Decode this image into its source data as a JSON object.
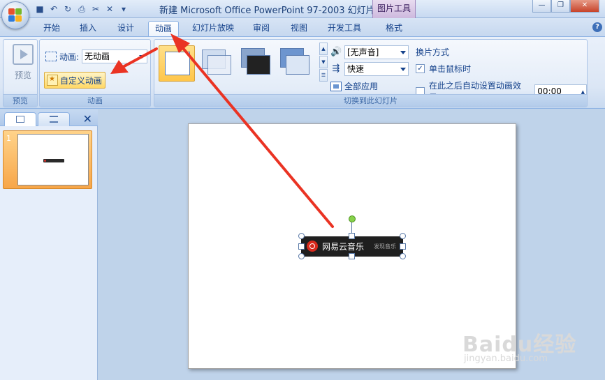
{
  "titlebar": {
    "title": "新建 Microsoft Office PowerPoint 97-2003 幻灯片...",
    "context_tab": "图片工具",
    "qat_icons": [
      "save-icon",
      "undo-icon",
      "redo-icon",
      "print-preview-icon",
      "customize-icon"
    ]
  },
  "tabs": [
    "开始",
    "插入",
    "设计",
    "动画",
    "幻灯片放映",
    "审阅",
    "视图",
    "开发工具",
    "格式"
  ],
  "active_tab": "动画",
  "ribbon": {
    "preview_group": {
      "button": "预览",
      "label": "预览"
    },
    "animation_group": {
      "anim_label": "动画:",
      "anim_value": "无动画",
      "custom_button": "自定义动画",
      "label": "动画"
    },
    "transition_group": {
      "sound_value": "[无声音]",
      "speed_value": "快速",
      "apply_all": "全部应用",
      "label": "切换到此幻灯片",
      "switch_title": "换片方式",
      "on_click": "单击鼠标时",
      "on_click_checked": "✓",
      "auto_after": "在此之后自动设置动画效果:",
      "auto_time": "00:00"
    }
  },
  "slides_pane": {
    "slide_number": "1"
  },
  "slide": {
    "banner_title": "网易云音乐",
    "banner_sub": "发现音乐"
  },
  "watermark": {
    "brand": "Baidu经验",
    "url": "jingyan.baidu.com"
  },
  "colors": {
    "ribbon_blue": "#dbe6f5",
    "highlight": "#ffd865",
    "arrow_red": "#ea3323",
    "banner_bg": "#1f1f1f"
  }
}
